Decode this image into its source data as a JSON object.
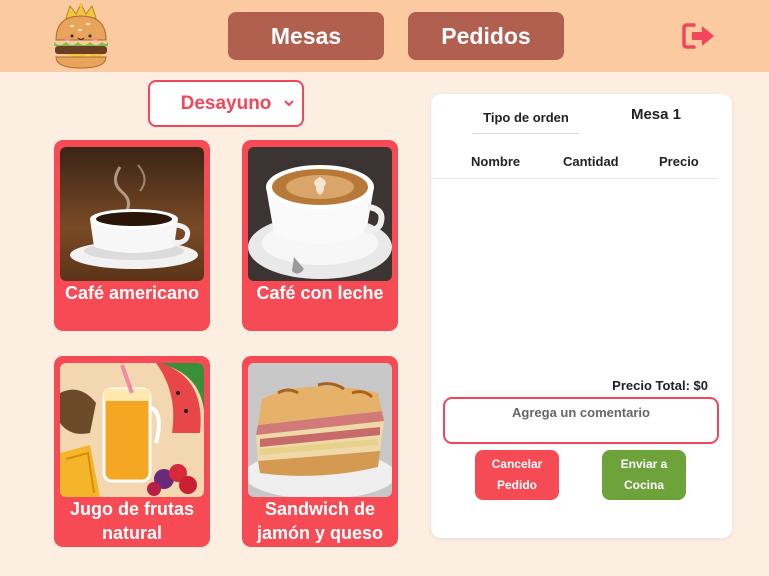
{
  "header": {
    "nav": [
      {
        "label": "Mesas"
      },
      {
        "label": "Pedidos"
      }
    ],
    "logo_icon": "burger-king-logo",
    "logout_icon": "logout-icon",
    "colors": {
      "header_bg": "#fccaa0",
      "nav_bg": "#b15f4f",
      "accent": "#f2465a"
    }
  },
  "menu": {
    "category": {
      "selected": "Desayuno"
    },
    "products": [
      {
        "name": "Café americano",
        "image": "coffee-cup-photo"
      },
      {
        "name": "Café con leche",
        "image": "latte-art-photo"
      },
      {
        "name": "Jugo de frutas natural",
        "image": "fruit-juice-photo"
      },
      {
        "name": "Sandwich de jamón y queso",
        "image": "ham-cheese-sandwich-photo"
      }
    ]
  },
  "order": {
    "order_type_label": "Tipo de orden",
    "table_label": "Mesa 1",
    "columns": [
      "Nombre",
      "Cantidad",
      "Precio"
    ],
    "items": [],
    "total_label": "Precio Total: $0",
    "comment_placeholder": "Agrega un comentario",
    "cancel_label_line1": "Cancelar",
    "cancel_label_line2": "Pedido",
    "send_label_line1": "Enviar a",
    "send_label_line2": "Cocina",
    "colors": {
      "cancel": "#f64b55",
      "send": "#6ea23b"
    }
  }
}
